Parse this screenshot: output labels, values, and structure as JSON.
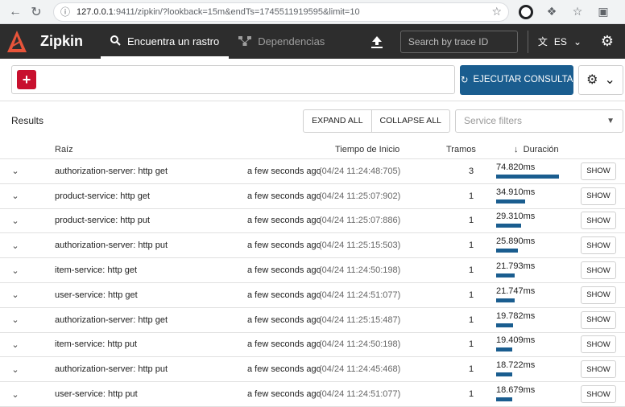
{
  "browser": {
    "url_host": "127.0.0.1",
    "url_rest": ":9411/zipkin/?lookback=15m&endTs=1745511919595&limit=10"
  },
  "header": {
    "brand": "Zipkin",
    "tabs": [
      {
        "label": "Encuentra un rastro",
        "active": true
      },
      {
        "label": "Dependencias",
        "active": false
      }
    ],
    "trace_search_placeholder": "Search by trace ID",
    "language": "ES"
  },
  "query": {
    "run_label": "EJECUTAR CONSULTA"
  },
  "results": {
    "title": "Results",
    "expand_all": "EXPAND ALL",
    "collapse_all": "COLLAPSE ALL",
    "service_filter_placeholder": "Service filters",
    "columns": {
      "root": "Raíz",
      "start": "Tiempo de Inicio",
      "spans": "Tramos",
      "duration": "Duración"
    },
    "show_label": "SHOW",
    "rows": [
      {
        "root": "authorization-server: http get",
        "ago": "a few seconds ago",
        "ts": "(04/24 11:24:48:705)",
        "spans": "3",
        "duration": "74.820ms",
        "rel": 1.0
      },
      {
        "root": "product-service: http get",
        "ago": "a few seconds ago",
        "ts": "(04/24 11:25:07:902)",
        "spans": "1",
        "duration": "34.910ms",
        "rel": 0.467
      },
      {
        "root": "product-service: http put",
        "ago": "a few seconds ago",
        "ts": "(04/24 11:25:07:886)",
        "spans": "1",
        "duration": "29.310ms",
        "rel": 0.392
      },
      {
        "root": "authorization-server: http put",
        "ago": "a few seconds ago",
        "ts": "(04/24 11:25:15:503)",
        "spans": "1",
        "duration": "25.890ms",
        "rel": 0.346
      },
      {
        "root": "item-service: http get",
        "ago": "a few seconds ago",
        "ts": "(04/24 11:24:50:198)",
        "spans": "1",
        "duration": "21.793ms",
        "rel": 0.291
      },
      {
        "root": "user-service: http get",
        "ago": "a few seconds ago",
        "ts": "(04/24 11:24:51:077)",
        "spans": "1",
        "duration": "21.747ms",
        "rel": 0.291
      },
      {
        "root": "authorization-server: http get",
        "ago": "a few seconds ago",
        "ts": "(04/24 11:25:15:487)",
        "spans": "1",
        "duration": "19.782ms",
        "rel": 0.264
      },
      {
        "root": "item-service: http put",
        "ago": "a few seconds ago",
        "ts": "(04/24 11:24:50:198)",
        "spans": "1",
        "duration": "19.409ms",
        "rel": 0.259
      },
      {
        "root": "authorization-server: http put",
        "ago": "a few seconds ago",
        "ts": "(04/24 11:24:45:468)",
        "spans": "1",
        "duration": "18.722ms",
        "rel": 0.25
      },
      {
        "root": "user-service: http put",
        "ago": "a few seconds ago",
        "ts": "(04/24 11:24:51:077)",
        "spans": "1",
        "duration": "18.679ms",
        "rel": 0.25
      }
    ]
  }
}
